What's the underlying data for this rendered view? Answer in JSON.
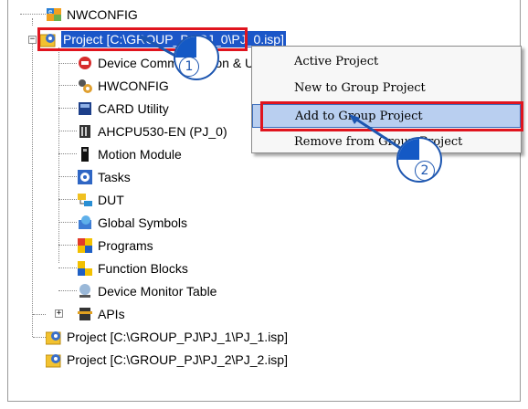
{
  "tree": {
    "root": "NWCONFIG",
    "project0": "Project [C:\\GROUP_PJ\\PJ_0\\PJ_0.isp]",
    "children": [
      {
        "label": "Device Communication & Utility",
        "icon": "device-comm-icon"
      },
      {
        "label": "HWCONFIG",
        "icon": "hwconfig-icon"
      },
      {
        "label": "CARD Utility",
        "icon": "card-icon"
      },
      {
        "label": "AHCPU530-EN (PJ_0)",
        "icon": "cpu-icon"
      },
      {
        "label": "Motion Module",
        "icon": "motion-module-icon"
      },
      {
        "label": "Tasks",
        "icon": "tasks-icon"
      },
      {
        "label": "DUT",
        "icon": "dut-icon"
      },
      {
        "label": "Global Symbols",
        "icon": "global-symbols-icon"
      },
      {
        "label": "Programs",
        "icon": "programs-icon"
      },
      {
        "label": "Function Blocks",
        "icon": "function-blocks-icon"
      },
      {
        "label": "Device Monitor Table",
        "icon": "device-monitor-icon"
      },
      {
        "label": "APIs",
        "icon": "apis-icon"
      }
    ],
    "project1": "Project [C:\\GROUP_PJ\\PJ_1\\PJ_1.isp]",
    "project2": "Project [C:\\GROUP_PJ\\PJ_2\\PJ_2.isp]"
  },
  "context_menu": {
    "items": [
      "Active Project",
      "New to Group Project",
      "Add to Group Project",
      "Remove from Group Project"
    ],
    "highlighted": "Add to Group Project"
  },
  "callouts": {
    "step1": "1",
    "step2": "2"
  },
  "colors": {
    "highlight_box": "#e0141e",
    "selection": "#1b56c8",
    "callout": "#1459c5",
    "menu_hover": "#b9cff0"
  }
}
